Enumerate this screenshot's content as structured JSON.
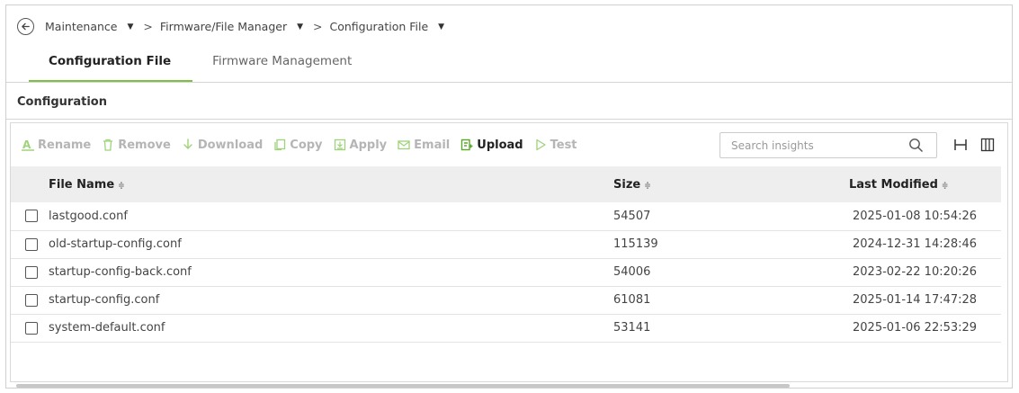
{
  "breadcrumb": {
    "items": [
      {
        "label": "Maintenance"
      },
      {
        "label": "Firmware/File Manager"
      },
      {
        "label": "Configuration File"
      }
    ],
    "separator": ">",
    "caret": "▼"
  },
  "tabs": [
    {
      "label": "Configuration File",
      "active": true
    },
    {
      "label": "Firmware Management",
      "active": false
    }
  ],
  "section": {
    "title": "Configuration"
  },
  "toolbar": {
    "rename_label": "Rename",
    "remove_label": "Remove",
    "download_label": "Download",
    "copy_label": "Copy",
    "apply_label": "Apply",
    "email_label": "Email",
    "upload_label": "Upload",
    "test_label": "Test",
    "search_placeholder": "Search insights",
    "accent_color": "#5aa82a",
    "disabled_color": "#b5b5b5"
  },
  "table": {
    "columns": {
      "name": "File Name",
      "size": "Size",
      "modified": "Last Modified",
      "sort_glyph": "≑"
    },
    "rows": [
      {
        "name": "lastgood.conf",
        "size": "54507",
        "modified": "2025-01-08 10:54:26"
      },
      {
        "name": "old-startup-config.conf",
        "size": "115139",
        "modified": "2024-12-31 14:28:46"
      },
      {
        "name": "startup-config-back.conf",
        "size": "54006",
        "modified": "2023-02-22 10:20:26"
      },
      {
        "name": "startup-config.conf",
        "size": "61081",
        "modified": "2025-01-14 17:47:28"
      },
      {
        "name": "system-default.conf",
        "size": "53141",
        "modified": "2025-01-06 22:53:29"
      }
    ]
  },
  "colors": {
    "tab_underline": "#7cc242",
    "header_bg": "#eeeeee"
  }
}
